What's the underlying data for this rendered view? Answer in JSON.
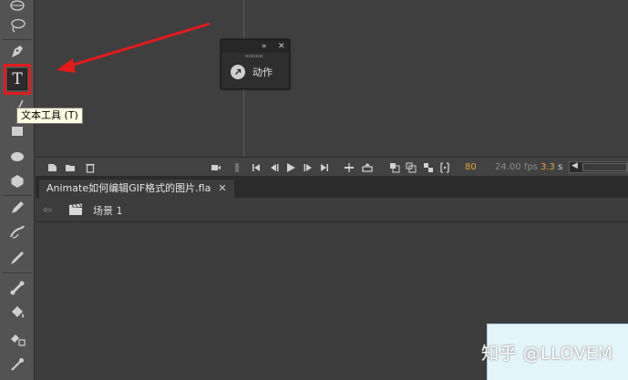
{
  "tooltip": {
    "text": "文本工具 (T)"
  },
  "toolbar": {
    "text_tool_glyph": "T",
    "tools": [
      "subselection-icon",
      "lasso-icon",
      "pen-icon",
      "text-icon",
      "line-icon",
      "rectangle-icon",
      "oval-icon",
      "polystar-icon",
      "pencil-icon",
      "brush-icon",
      "paint-brush-icon",
      "bone-icon",
      "paint-bucket-icon",
      "ink-bottle-icon",
      "eyedropper-icon"
    ]
  },
  "actions_panel": {
    "expand_glyph": "»",
    "close_glyph": "✕",
    "label": "动作"
  },
  "timeline": {
    "current_frame": "80",
    "fps": "24.00 fps",
    "elapsed": "3.3",
    "elapsed_unit": "s",
    "frame_color": "#e8a33a"
  },
  "document": {
    "tab_title": "Animate如何编辑GIF格式的图片.fla",
    "close_glyph": "✕"
  },
  "scene": {
    "label": "场景 1"
  },
  "watermark": {
    "text": "知乎 @LLOVEM"
  },
  "colors": {
    "highlight_red": "#e31b1b",
    "panel_bg": "#3c3c3c",
    "toolbar_bg": "#535353",
    "stage_color": "#e3f4fb"
  }
}
